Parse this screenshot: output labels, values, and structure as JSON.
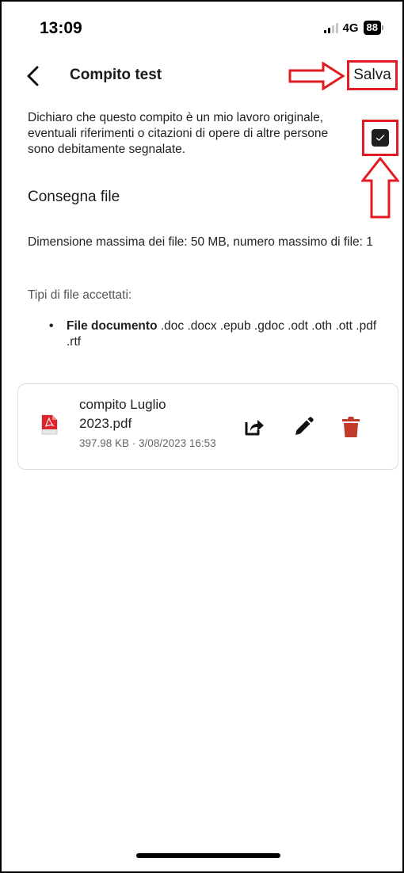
{
  "status_bar": {
    "time": "13:09",
    "network": "4G",
    "battery": "88"
  },
  "header": {
    "title": "Compito test",
    "save_label": "Salva"
  },
  "declaration": {
    "text": "Dichiaro che questo compito è un mio lavoro originale, eventuali riferimenti o citazioni di opere di altre persone sono debitamente segnalate.",
    "checked": true
  },
  "submission": {
    "title": "Consegna file",
    "limits": "Dimensione massima dei file: 50 MB, numero massimo di file: 1",
    "accepted_label": "Tipi di file accettati:",
    "file_types": {
      "label": "File documento",
      "extensions": " .doc .docx .epub .gdoc .odt .oth .ott .pdf .rtf"
    }
  },
  "file": {
    "name": "compito Luglio 2023.pdf",
    "meta": "397.98 KB · 3/08/2023 16:53"
  },
  "colors": {
    "annotation": "#e21a22",
    "delete": "#c0392b",
    "pdf": "#d9252b"
  },
  "icons": {
    "back": "chevron-left-icon",
    "share": "share-icon",
    "edit": "pencil-icon",
    "delete": "trash-icon",
    "file": "pdf-file-icon"
  }
}
